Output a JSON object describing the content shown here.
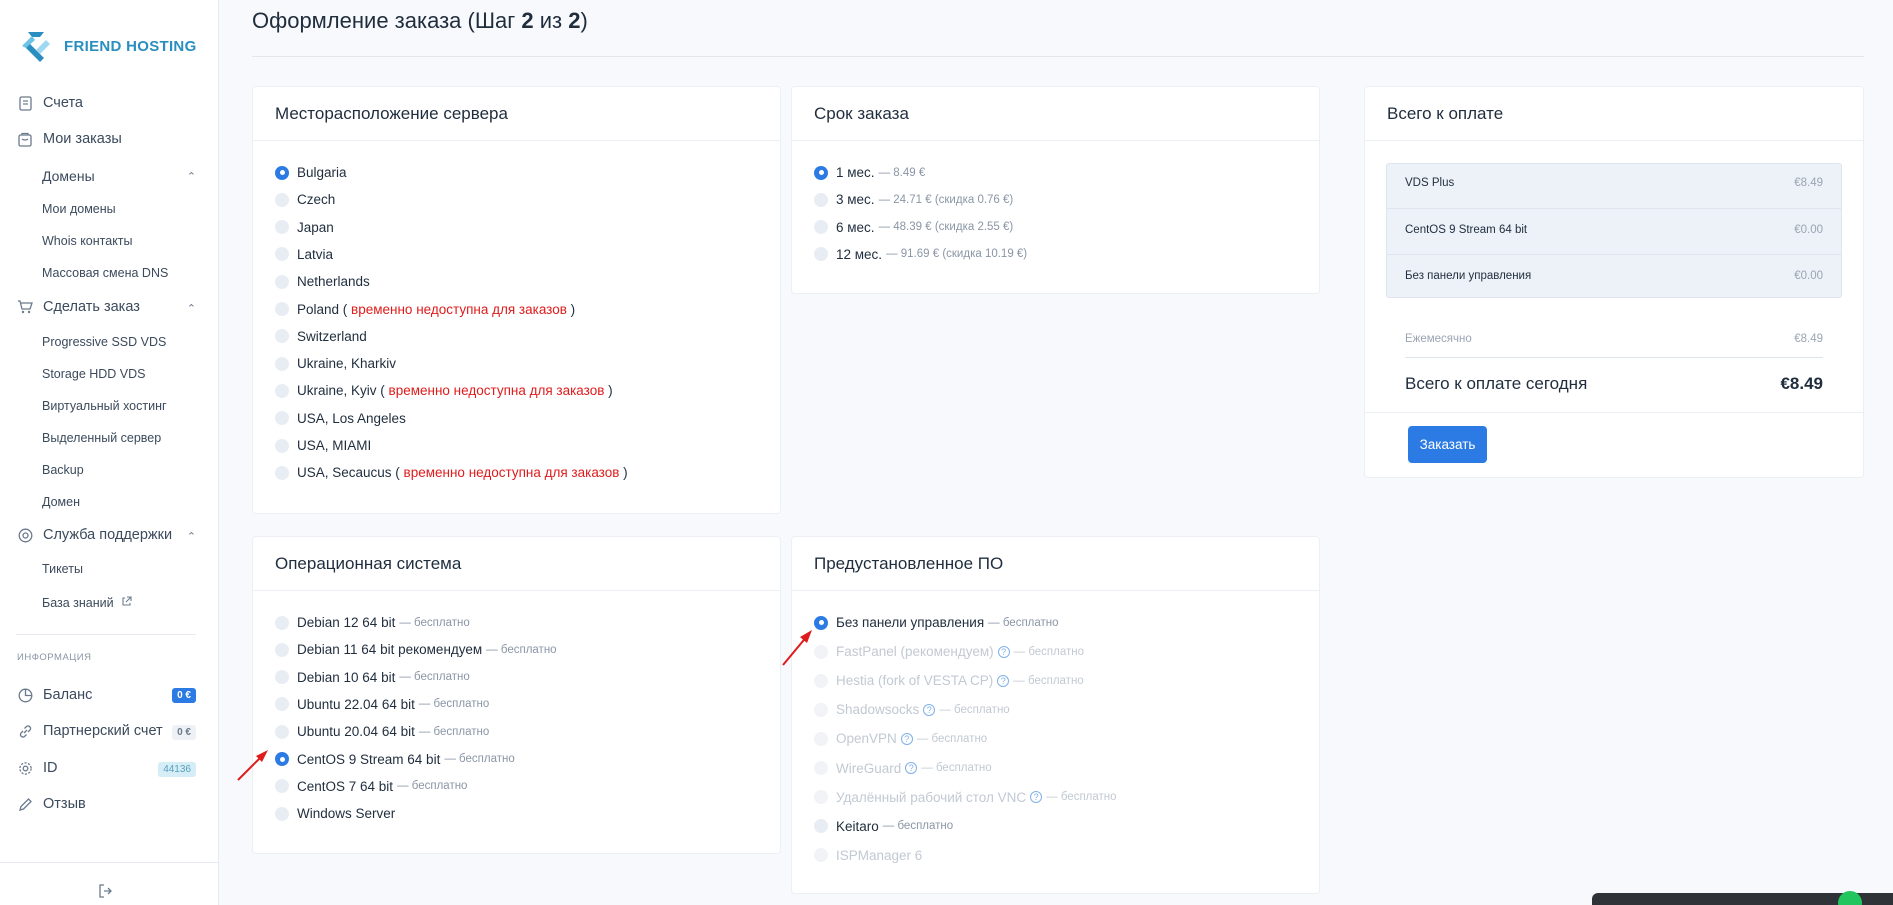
{
  "brand": {
    "name": "FRIEND HOSTING"
  },
  "sidebar": {
    "items": [
      {
        "label": "Счета",
        "icon": "invoice-icon"
      },
      {
        "label": "Мои заказы",
        "icon": "box-icon"
      }
    ],
    "domains": {
      "label": "Домены",
      "subitems": [
        "Мои домены",
        "Whois контакты",
        "Массовая смена DNS"
      ]
    },
    "order": {
      "label": "Сделать заказ",
      "icon": "cart-icon",
      "subitems": [
        "Progressive SSD VDS",
        "Storage HDD VDS",
        "Виртуальный хостинг",
        "Выделенный сервер",
        "Backup",
        "Домен"
      ]
    },
    "support": {
      "label": "Служба поддержки",
      "icon": "lifebuoy-icon",
      "subitems": [
        "Тикеты",
        "База знаний"
      ]
    },
    "info_title": "ИНФОРМАЦИЯ",
    "info": [
      {
        "label": "Баланс",
        "icon": "pie-icon",
        "badge": "0 €"
      },
      {
        "label": "Партнерский счет",
        "icon": "link-icon",
        "badge": "0 €"
      },
      {
        "label": "ID",
        "icon": "gear-icon",
        "badge": "44136"
      },
      {
        "label": "Отзыв",
        "icon": "pencil-icon"
      }
    ]
  },
  "page": {
    "title_prefix": "Оформление заказа (Шаг ",
    "step": "2",
    "of": " из ",
    "total_steps": "2",
    "title_suffix": ")"
  },
  "location": {
    "title": "Месторасположение сервера",
    "unavailable_note": "временно недоступна для заказов",
    "options": [
      {
        "label": "Bulgaria",
        "selected": true
      },
      {
        "label": "Czech"
      },
      {
        "label": "Japan"
      },
      {
        "label": "Latvia"
      },
      {
        "label": "Netherlands"
      },
      {
        "label": "Poland",
        "unavailable": true
      },
      {
        "label": "Switzerland"
      },
      {
        "label": "Ukraine, Kharkiv"
      },
      {
        "label": "Ukraine, Kyiv",
        "unavailable": true
      },
      {
        "label": "USA, Los Angeles"
      },
      {
        "label": "USA, MIAMI"
      },
      {
        "label": "USA, Secaucus",
        "unavailable": true
      }
    ]
  },
  "term": {
    "title": "Срок заказа",
    "options": [
      {
        "label": "1 мес.",
        "note": "— 8.49 €",
        "selected": true
      },
      {
        "label": "3 мес.",
        "note": "— 24.71 € (скидка 0.76 €)"
      },
      {
        "label": "6 мес.",
        "note": "— 48.39 € (скидка 2.55 €)"
      },
      {
        "label": "12 мес.",
        "note": "— 91.69 € (скидка 10.19 €)"
      }
    ]
  },
  "os": {
    "title": "Операционная система",
    "options": [
      {
        "label": "Debian 12 64 bit",
        "note": "— бесплатно"
      },
      {
        "label": "Debian 11 64 bit рекомендуем",
        "note": "— бесплатно"
      },
      {
        "label": "Debian 10 64 bit",
        "note": "— бесплатно"
      },
      {
        "label": "Ubuntu 22.04 64 bit",
        "note": "— бесплатно"
      },
      {
        "label": "Ubuntu 20.04 64 bit",
        "note": "— бесплатно"
      },
      {
        "label": "CentOS 9 Stream 64 bit",
        "note": "— бесплатно",
        "selected": true
      },
      {
        "label": "CentOS 7 64 bit",
        "note": "— бесплатно"
      },
      {
        "label": "Windows Server",
        "note": ""
      }
    ]
  },
  "software": {
    "title": "Предустановленное ПО",
    "options": [
      {
        "label": "Без панели управления",
        "note": "— бесплатно",
        "selected": true
      },
      {
        "label": "FastPanel (рекомендуем)",
        "note": "— бесплатно",
        "disabled": true,
        "help": true
      },
      {
        "label": "Hestia (fork of VESTA CP)",
        "note": "— бесплатно",
        "disabled": true,
        "help": true
      },
      {
        "label": "Shadowsocks",
        "note": "— бесплатно",
        "disabled": true,
        "help": true
      },
      {
        "label": "OpenVPN",
        "note": "— бесплатно",
        "disabled": true,
        "help": true
      },
      {
        "label": "WireGuard",
        "note": "— бесплатно",
        "disabled": true,
        "help": true
      },
      {
        "label": "Удалённый рабочий стол VNC",
        "note": "— бесплатно",
        "disabled": true,
        "help": true
      },
      {
        "label": "Keitaro",
        "note": "— бесплатно"
      },
      {
        "label": "ISPManager 6",
        "note": "",
        "disabled": true
      }
    ]
  },
  "summary": {
    "title": "Всего к оплате",
    "lines": [
      {
        "label": "VDS Plus",
        "price": "€8.49"
      },
      {
        "label": "CentOS 9 Stream 64 bit",
        "price": "€0.00"
      },
      {
        "label": "Без панели управления",
        "price": "€0.00"
      }
    ],
    "monthly_label": "Ежемесячно",
    "monthly_value": "€8.49",
    "total_label": "Всего к оплате сегодня",
    "total_value": "€8.49",
    "order_button": "Заказать"
  },
  "colors": {
    "accent": "#2c7be5",
    "danger": "#e01b1b",
    "arrow": "#e01b1b"
  }
}
